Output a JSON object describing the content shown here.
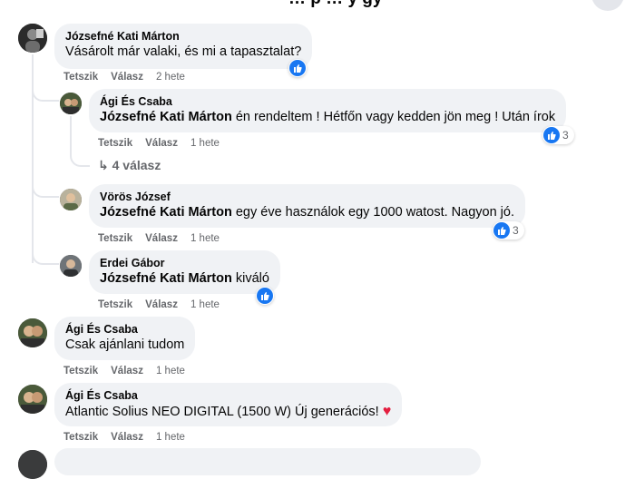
{
  "header": {
    "title": "… p … y gy"
  },
  "comments": [
    {
      "author": "Józsefné Kati Márton",
      "text": "Vásárolt már valaki, és mi a tapasztalat?",
      "like_label": "Tetszik",
      "reply_label": "Válasz",
      "time": "2 hete",
      "reaction": {
        "type": "like",
        "count": ""
      },
      "replies": [
        {
          "author": "Ági És Csaba",
          "mention": "Józsefné Kati Márton",
          "text": " én rendeltem ! Hétfőn vagy kedden jön meg ! Után írok",
          "like_label": "Tetszik",
          "reply_label": "Válasz",
          "time": "1 hete",
          "reaction": {
            "type": "like",
            "count": "3"
          },
          "more_replies": "4 válasz"
        },
        {
          "author": "Vörös József",
          "mention": "Józsefné Kati Márton",
          "text": " egy éve használok egy 1000 watost. Nagyon jó.",
          "like_label": "Tetszik",
          "reply_label": "Válasz",
          "time": "1 hete",
          "reaction": {
            "type": "like",
            "count": "3"
          }
        },
        {
          "author": "Erdei Gábor",
          "mention": "Józsefné Kati Márton",
          "text": " kiváló",
          "like_label": "Tetszik",
          "reply_label": "Válasz",
          "time": "1 hete",
          "reaction": {
            "type": "like",
            "count": ""
          }
        }
      ]
    },
    {
      "author": "Ági És Csaba",
      "text": "Csak ajánlani tudom",
      "like_label": "Tetszik",
      "reply_label": "Válasz",
      "time": "1 hete"
    },
    {
      "author": "Ági És Csaba",
      "text": "Atlantic Solius NEO DIGITAL (1500 W) Új generációs!",
      "emoji": "♥",
      "like_label": "Tetszik",
      "reply_label": "Válasz",
      "time": "1 hete"
    }
  ],
  "colors": {
    "bubble": "#f0f2f5",
    "like_blue": "#1877f2",
    "meta_gray": "#65676b",
    "heart_red": "#e41e3f"
  }
}
